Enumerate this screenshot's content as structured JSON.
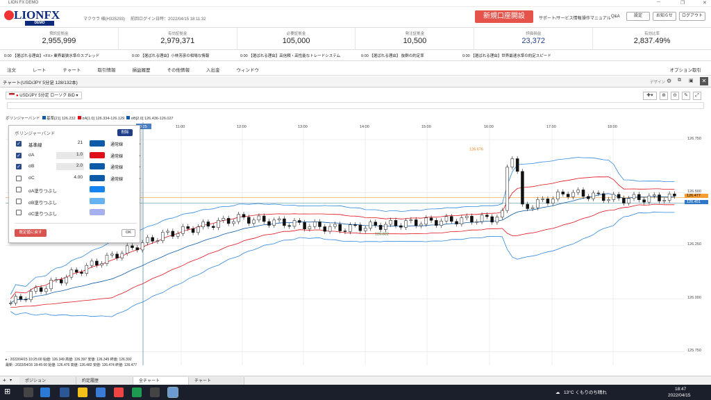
{
  "window": {
    "title": "LION FX DEMO"
  },
  "header": {
    "logo": "LIONFX",
    "logo_sub": "DEMO",
    "user": "マクウラ 様(H325293)",
    "last_login": "前回ログイン日時：2022/04/15 18:11:32",
    "open_account": "新規口座開設",
    "links": [
      "サポート/サービス情報",
      "操作マニュアル",
      "Q&A"
    ],
    "buttons": [
      "設定",
      "お知らせ",
      "ログアウト"
    ]
  },
  "summary": [
    {
      "label": "預託証拠金",
      "value": "2,955,999"
    },
    {
      "label": "有効証拠金",
      "value": "2,979,371"
    },
    {
      "label": "必要証拠金",
      "value": "105,000"
    },
    {
      "label": "発注証拠金",
      "value": "10,500"
    },
    {
      "label": "評価損益",
      "value": "23,372"
    },
    {
      "label": "有効比率",
      "value": "2,837.49%"
    }
  ],
  "ticker": [
    "0:00 【選ばれる理由】<FX> 業界最狭水準のスプレッド",
    "0:00 【選ばれる理由】小林芳彦の相場な情報",
    "0:00 【選ばれる理由】高信頼・高性能なトレードシステム",
    "0:00 【選ばれる理由】 抜群の約定率",
    "0:00 【選ばれる理由】世界最速水準の約定スピード"
  ],
  "menu": [
    "注文",
    "レート",
    "チャート",
    "取引情報",
    "損益履歴",
    "その他情報",
    "入出金",
    "ウィンドウ"
  ],
  "menu_right": "オプション取引",
  "chart_window": {
    "title": "チャート(USD/JPY 5分足 128/132本)",
    "label": "デザイン"
  },
  "chart_toolbar": {
    "symbol": "USD/JPY 5分足 ローソク BID"
  },
  "indicator_legend": {
    "name": "ボリンジャーバンド",
    "mid": "基準[21] 126.232",
    "a": "σA[1.0] 126.334-126.129",
    "b": "σB[2.0] 126.436-126.027"
  },
  "bb_panel": {
    "title": "ボリンジャーバンド",
    "delete": "削除",
    "rows": [
      {
        "checked": true,
        "label": "基準線",
        "value": "21",
        "color": "#0c5aa8",
        "style": "通常線",
        "shade": false
      },
      {
        "checked": true,
        "label": "σA",
        "value": "1.0",
        "color": "#e0101a",
        "style": "通常線",
        "shade": true
      },
      {
        "checked": true,
        "label": "σB",
        "value": "2.0",
        "color": "#0c5aa8",
        "style": "通常線",
        "shade": true
      },
      {
        "checked": false,
        "label": "σC",
        "value": "4.00",
        "color": "#0c5aa8",
        "style": "通常線",
        "shade": false
      },
      {
        "checked": false,
        "label": "σA塗りつぶし",
        "value": "",
        "color": "#1584f0",
        "style": "",
        "shade": false
      },
      {
        "checked": false,
        "label": "σB塗りつぶし",
        "value": "",
        "color": "#66b2f2",
        "style": "",
        "shade": false
      },
      {
        "checked": false,
        "label": "σC塗りつぶし",
        "value": "",
        "color": "#a7b0ef",
        "style": "",
        "shade": false
      }
    ],
    "preset": "既定値に戻す",
    "ok": "OK"
  },
  "chart": {
    "times": [
      "10:25",
      "11:00",
      "12:00",
      "13:00",
      "14:00",
      "15:00",
      "16:00",
      "17:00",
      "18:00"
    ],
    "yticks": [
      "126.750",
      "126.500",
      "126.250",
      "126.000",
      "125.750"
    ],
    "current_price": "126.477",
    "secondary_price": "126.451",
    "high_label": "126.676",
    "low_label": "126.322"
  },
  "ohlc": {
    "row1": "▸ : 2022/04/15 10:25:00 始値: 126.349 高値: 126.397 安値: 126.345 終値: 126.392",
    "row2": "最新 : 2022/04/15 18:45:00 始値: 126.476 高値: 126.482 安値: 126.474 終値: 126.477"
  },
  "tabs": [
    "ポジション",
    "約定履歴",
    "全チャート",
    "チャート"
  ],
  "taskbar": {
    "weather": "13°C くもりのち晴れ",
    "time": "18:47",
    "date": "2022/04/15"
  }
}
